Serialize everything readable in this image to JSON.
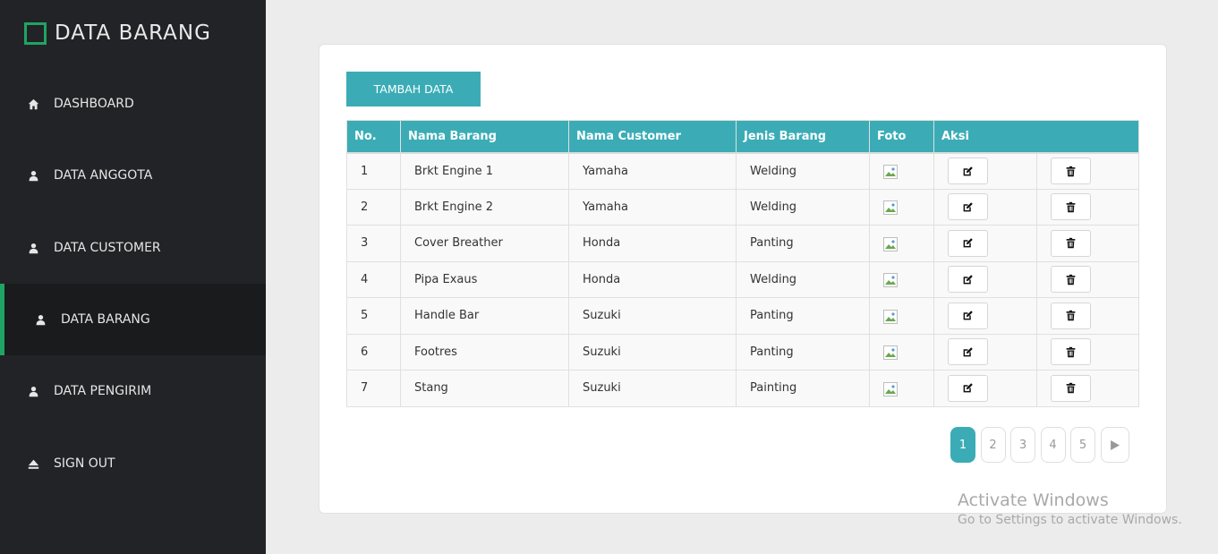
{
  "sidebar": {
    "brand": "DATA BARANG",
    "accent": "#1fa463",
    "items": [
      {
        "label": "DASHBOARD",
        "icon": "home-icon"
      },
      {
        "label": "DATA ANGGOTA",
        "icon": "user-icon"
      },
      {
        "label": "DATA CUSTOMER",
        "icon": "user-icon"
      },
      {
        "label": "DATA BARANG",
        "icon": "user-icon",
        "active": true
      },
      {
        "label": "DATA PENGIRIM",
        "icon": "user-icon"
      },
      {
        "label": "SIGN OUT",
        "icon": "eject-icon"
      }
    ]
  },
  "main": {
    "add_button": "TAMBAH DATA",
    "header_color": "#3bacb6",
    "columns": [
      "No.",
      "Nama Barang",
      "Nama Customer",
      "Jenis Barang",
      "Foto",
      "Aksi"
    ],
    "rows": [
      {
        "no": "1",
        "nama_barang": "Brkt Engine 1",
        "nama_customer": "Yamaha",
        "jenis_barang": "Welding"
      },
      {
        "no": "2",
        "nama_barang": "Brkt Engine 2",
        "nama_customer": "Yamaha",
        "jenis_barang": "Welding"
      },
      {
        "no": "3",
        "nama_barang": "Cover Breather",
        "nama_customer": "Honda",
        "jenis_barang": "Panting"
      },
      {
        "no": "4",
        "nama_barang": "Pipa Exaus",
        "nama_customer": "Honda",
        "jenis_barang": "Welding"
      },
      {
        "no": "5",
        "nama_barang": "Handle Bar",
        "nama_customer": "Suzuki",
        "jenis_barang": "Panting"
      },
      {
        "no": "6",
        "nama_barang": "Footres",
        "nama_customer": "Suzuki",
        "jenis_barang": "Panting"
      },
      {
        "no": "7",
        "nama_barang": "Stang",
        "nama_customer": "Suzuki",
        "jenis_barang": "Painting"
      }
    ],
    "pagination": {
      "pages": [
        "1",
        "2",
        "3",
        "4",
        "5"
      ],
      "current": "1",
      "next_icon": "play-icon"
    }
  },
  "watermark": {
    "title": "Activate Windows",
    "subtitle": "Go to Settings to activate Windows."
  }
}
